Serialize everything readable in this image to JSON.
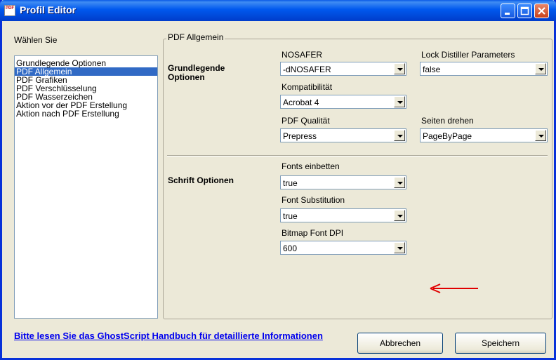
{
  "window": {
    "title": "Profil Editor",
    "icon_text": "PDF",
    "controls": [
      "minimize-icon",
      "maximize-icon",
      "close-icon"
    ]
  },
  "sidebar": {
    "label": "Wählen Sie",
    "items": [
      {
        "label": "Grundlegende Optionen",
        "selected": false
      },
      {
        "label": "PDF Allgemein",
        "selected": true
      },
      {
        "label": "PDF Grafiken",
        "selected": false
      },
      {
        "label": "PDF Verschlüsselung",
        "selected": false
      },
      {
        "label": "PDF Wasserzeichen",
        "selected": false
      },
      {
        "label": "Aktion vor der PDF Erstellung",
        "selected": false
      },
      {
        "label": "Aktion nach PDF Erstellung",
        "selected": false
      }
    ]
  },
  "panel": {
    "title": "PDF Allgemein",
    "basic": {
      "label": "Grundlegende\nOptionen",
      "nosafer_label": "NOSAFER",
      "nosafer_value": "-dNOSAFER",
      "lock_label": "Lock Distiller Parameters",
      "lock_value": "false",
      "compat_label": "Kompatibilität",
      "compat_value": "Acrobat 4",
      "quality_label": "PDF Qualität",
      "quality_value": "Prepress",
      "rotate_label": "Seiten drehen",
      "rotate_value": "PageByPage"
    },
    "fonts": {
      "label": "Schrift Optionen",
      "embed_label": "Fonts einbetten",
      "embed_value": "true",
      "subst_label": "Font Substitution",
      "subst_value": "true",
      "dpi_label": "Bitmap Font DPI",
      "dpi_value": "600"
    }
  },
  "footer": {
    "link_text": "Bitte lesen Sie das GhostScript Handbuch für detaillierte Informationen",
    "cancel_label": "Abbrechen",
    "save_label": "Speichern"
  },
  "colors": {
    "titlebar": "#0054e3",
    "selection": "#316ac5",
    "link": "#0000ee",
    "annotation_arrow": "#e00000"
  }
}
